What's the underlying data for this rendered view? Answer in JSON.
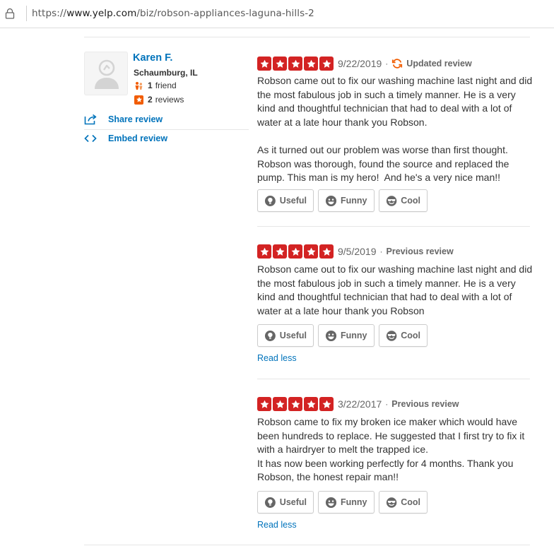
{
  "browser": {
    "url_prefix": "https://",
    "url_domain": "www.yelp.com",
    "url_path": "/biz/robson-appliances-laguna-hills-2"
  },
  "user": {
    "name": "Karen F.",
    "location": "Schaumburg, IL",
    "friends_count": "1",
    "friends_label": "friend",
    "reviews_count": "2",
    "reviews_label": "reviews"
  },
  "actions": {
    "share": "Share review",
    "embed": "Embed review"
  },
  "colors": {
    "star_red": "#d32323",
    "link_blue": "#0073bb",
    "updated_orange": "#f15c00"
  },
  "vote_labels": {
    "useful": "Useful",
    "funny": "Funny",
    "cool": "Cool"
  },
  "reviews": [
    {
      "rating": 5,
      "date": "9/22/2019",
      "dot": "·",
      "label": "Updated review",
      "text": "Robson came out to fix our washing machine last night and did the most fabulous job in such a timely manner. He is a very kind and thoughtful technician that had to deal with a lot of water at a late hour thank you Robson.\n\nAs it turned out our problem was worse than first thought. Robson was thorough, found the source and replaced the pump. This man is my hero!  And he's a very nice man!!"
    },
    {
      "rating": 5,
      "date": "9/5/2019",
      "dot": "·",
      "label": "Previous review",
      "text": "Robson came out to fix our washing machine last night and did the most fabulous job in such a timely manner. He is a very kind and thoughtful technician that had to deal with a lot of water at a late hour thank you Robson",
      "read_less": "Read less"
    },
    {
      "rating": 5,
      "date": "3/22/2017",
      "dot": "·",
      "label": "Previous review",
      "text": "Robson came to fix my broken ice maker which would have been hundreds to replace. He suggested that I first try to fix it with a hairdryer to melt the trapped ice.\nIt has now been working perfectly for 4 months. Thank you Robson, the honest repair man!!",
      "read_less": "Read less"
    }
  ]
}
